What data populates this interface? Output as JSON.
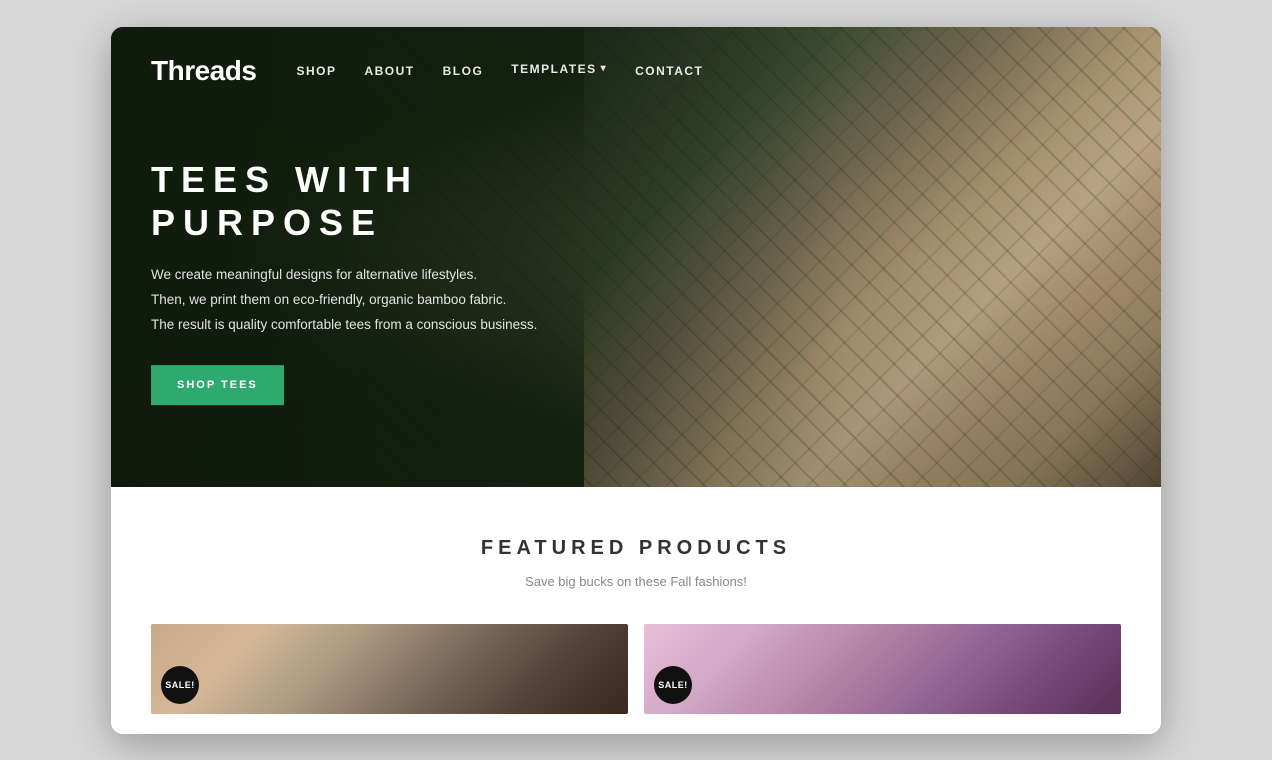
{
  "nav": {
    "logo": "Threads",
    "links": [
      {
        "label": "SHOP",
        "id": "shop"
      },
      {
        "label": "ABOUT",
        "id": "about"
      },
      {
        "label": "BLOG",
        "id": "blog"
      },
      {
        "label": "TEMPLATES",
        "id": "templates",
        "hasDropdown": true
      },
      {
        "label": "CONTACT",
        "id": "contact"
      }
    ]
  },
  "hero": {
    "title": "TEES WITH PURPOSE",
    "description_line1": "We create meaningful designs for alternative lifestyles.",
    "description_line2": "Then, we print them on eco-friendly, organic bamboo fabric.",
    "description_line3": "The result is quality comfortable tees from a conscious business.",
    "cta_label": "SHOP TEES"
  },
  "featured": {
    "title": "FEATURED PRODUCTS",
    "subtitle": "Save big bucks on these Fall fashions!",
    "sale_badge": "SALE!"
  }
}
